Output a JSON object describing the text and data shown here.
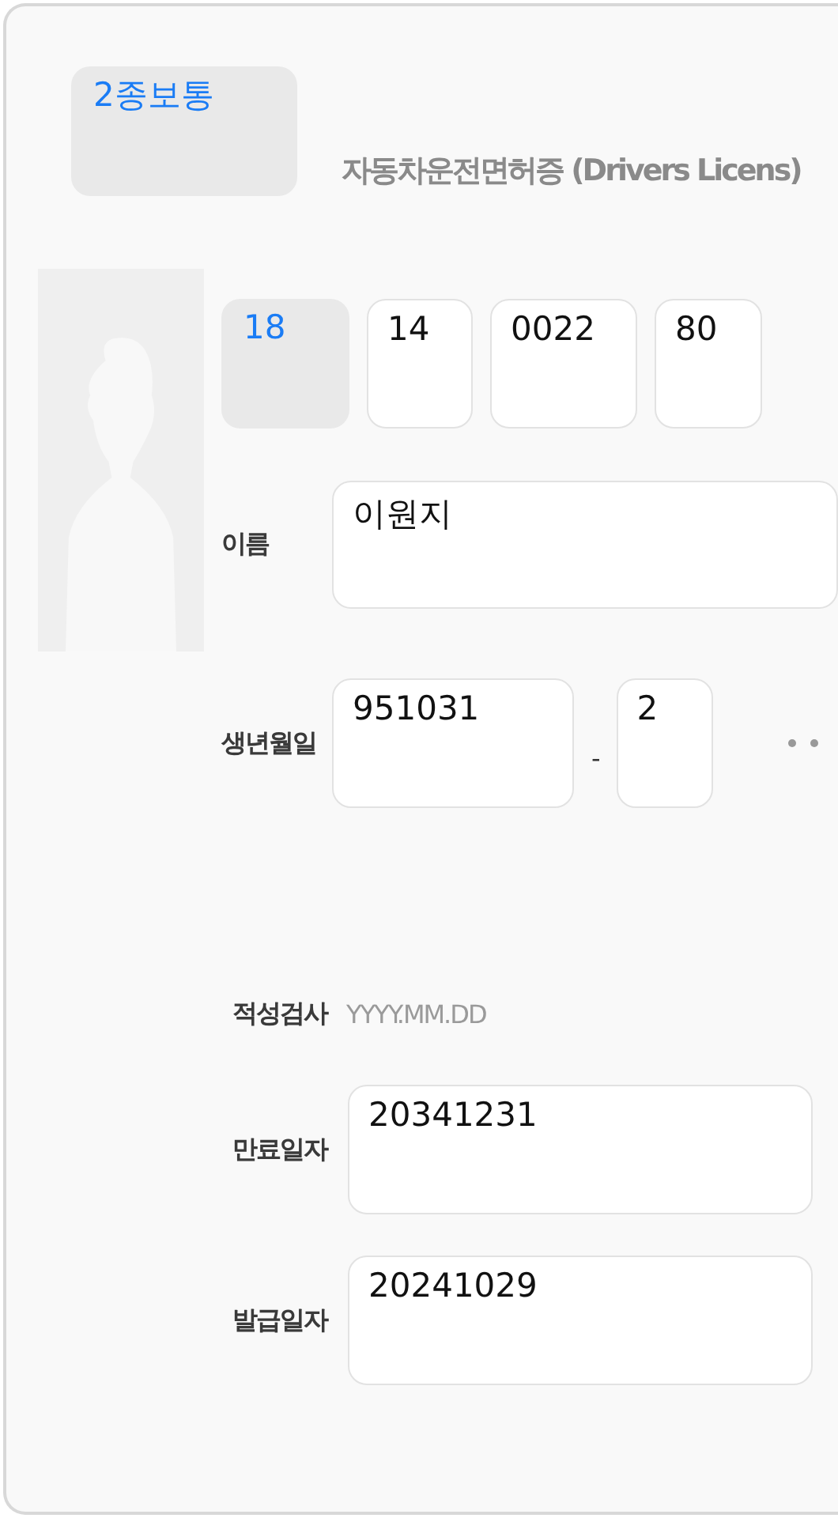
{
  "license_class": {
    "kind": "select",
    "value": "2종보통"
  },
  "title": "자동차운전면허증 (Drivers Licens)",
  "license_number": [
    {
      "kind": "select",
      "value": "18"
    },
    {
      "kind": "input",
      "value": "14"
    },
    {
      "kind": "input",
      "value": "0022"
    },
    {
      "kind": "input",
      "value": "80"
    }
  ],
  "name": {
    "label": "이름",
    "value": "이원지"
  },
  "birth": {
    "label": "생년월일",
    "front": "951031",
    "separator": "-",
    "back": "2",
    "masked": true
  },
  "aptitude_test": {
    "label": "적성검사",
    "placeholder": "YYYY.MM.DD"
  },
  "expiry_date": {
    "label": "만료일자",
    "value": "20341231"
  },
  "issue_date": {
    "label": "발급일자",
    "value": "20241029"
  }
}
